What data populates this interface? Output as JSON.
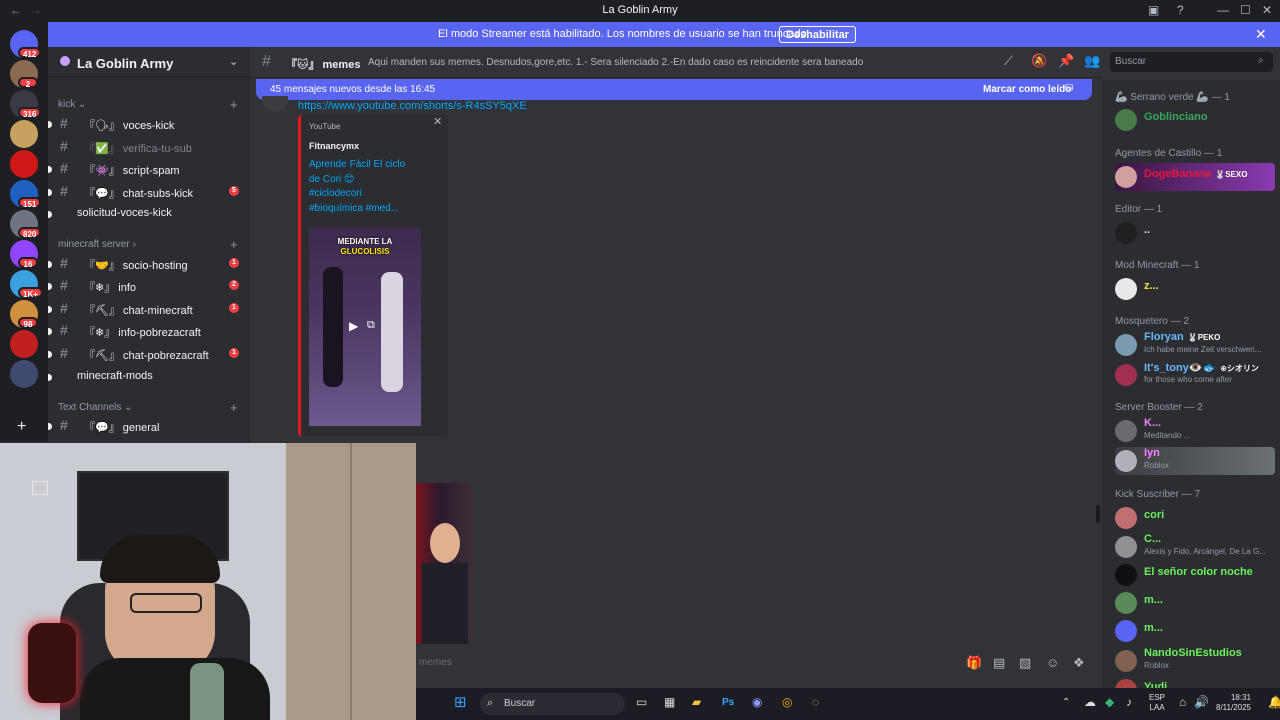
{
  "window": {
    "title": "La Goblin Army"
  },
  "banner": {
    "text": "El modo Streamer está habilitado. Los nombres de usuario se han truncado.",
    "button": "Deshabilitar"
  },
  "servers": [
    {
      "color": "#5865f2",
      "badge": "412"
    },
    {
      "color": "#8a6a50",
      "badge": "2"
    },
    {
      "color": "#3a3a44",
      "badge": "316"
    },
    {
      "color": "#c8a060",
      "badge": ""
    },
    {
      "color": "#d01818",
      "badge": ""
    },
    {
      "color": "#2060c0",
      "badge": "151"
    },
    {
      "color": "#707480",
      "badge": "820"
    },
    {
      "color": "#9146ff",
      "badge": "16"
    },
    {
      "color": "#3aa0e0",
      "badge": "1K+"
    },
    {
      "color": "#d09040",
      "badge": "98"
    },
    {
      "color": "#c02020",
      "badge": ""
    },
    {
      "color": "#404a70",
      "badge": ""
    }
  ],
  "sidebar": {
    "guild_name": "La Goblin Army",
    "categories": {
      "kick": "kick",
      "minecraft": "minecraft server",
      "text": "Text Channels"
    },
    "channels": [
      {
        "label": "『🗣』 voces-kick",
        "badge": ""
      },
      {
        "label": "『✅』 verifica-tu-sub",
        "badge": ""
      },
      {
        "label": "『👾』 script-spam",
        "badge": ""
      },
      {
        "label": "『💬』 chat-subs-kick",
        "badge": "5"
      },
      {
        "label": "solicitud-voces-kick",
        "badge": ""
      },
      {
        "label": "『🤝』 socio-hosting",
        "badge": "1"
      },
      {
        "label": "『❄』 info",
        "badge": "2"
      },
      {
        "label": "『⛏』 chat-minecraft",
        "badge": "1"
      },
      {
        "label": "『❄』 info-pobrezacraft",
        "badge": ""
      },
      {
        "label": "『⛏』 chat-pobrezacraft",
        "badge": "1"
      },
      {
        "label": "minecraft-mods",
        "badge": ""
      },
      {
        "label": "『💬』 general",
        "badge": ""
      }
    ]
  },
  "header": {
    "channel": "『🐱』 memes",
    "topic": "Aqui manden sus memes. Desnudos,gore,etc. 1.- Sera silenciado 2.-En dado caso es reincidente sera baneado",
    "search_placeholder": "Buscar"
  },
  "newbar": {
    "text": "45 mensajes nuevos desde las 16:45",
    "action": "Marcar como leído"
  },
  "message": {
    "link": "https://www.youtube.com/shorts/s-R4sSY5qXE",
    "embed": {
      "provider": "YouTube",
      "author": "Fitnancymx",
      "title_lines": [
        "Aprende Fácil El ciclo",
        "de Cori 😊",
        "#ciclodecori",
        "#bioquímica #med..."
      ],
      "thumb_text": [
        "MEDIANTE LA",
        "GLUCOLISIS"
      ]
    }
  },
  "composer": {
    "placeholder": "memes"
  },
  "members": {
    "roles": [
      {
        "label": "🦾 Serrano verde 🦾 — 1"
      },
      {
        "label": "Agentes de Castillo — 1"
      },
      {
        "label": "Editor — 1"
      },
      {
        "label": "Mod Minecraft — 1"
      },
      {
        "label": "Mosquetero — 2"
      },
      {
        "label": "Server Booster — 2"
      },
      {
        "label": "Kick Suscriber — 7"
      }
    ],
    "list": [
      {
        "name": "Goblinciano",
        "status": "",
        "tag": "",
        "color": "#3ba55c"
      },
      {
        "name": "DogeBanana",
        "status": "",
        "tag": "🐰SEXO",
        "color": "#e8183a"
      },
      {
        "name": "..",
        "status": "",
        "tag": "",
        "color": "#dbdee1"
      },
      {
        "name": "z...",
        "status": "",
        "tag": "",
        "color": "#f0e040"
      },
      {
        "name": "Floryan",
        "status": "Ich habe meine Zeit verschwen...",
        "tag": "🐰PEKO",
        "color": "#6ab7ff"
      },
      {
        "name": "It's_tony👁️🐟",
        "status": "for those who come after",
        "tag": "⊕シオリン",
        "color": "#6ab7ff"
      },
      {
        "name": "K...",
        "status": "Meditando ...",
        "tag": "",
        "color": "#f47fff"
      },
      {
        "name": "Iyn",
        "status": "Roblox",
        "tag": "",
        "color": "#f47fff"
      },
      {
        "name": "cori",
        "status": "",
        "tag": "",
        "color": "#6cf25e"
      },
      {
        "name": "C...",
        "status": "Alexis y Fido, Arcángel, De La G...",
        "tag": "",
        "color": "#6cf25e"
      },
      {
        "name": "El señor color noche",
        "status": "",
        "tag": "",
        "color": "#6cf25e"
      },
      {
        "name": "m...",
        "status": "",
        "tag": "",
        "color": "#6cf25e"
      },
      {
        "name": "m...",
        "status": "",
        "tag": "",
        "color": "#6cf25e"
      },
      {
        "name": "NandoSinEstudios",
        "status": "Roblox",
        "tag": "",
        "color": "#6cf25e"
      },
      {
        "name": "Yudi",
        "status": "",
        "tag": "",
        "color": "#6cf25e"
      }
    ]
  },
  "taskbar": {
    "search": "Buscar",
    "lang": "ESP",
    "lang2": "LAA",
    "time": "18:31",
    "date": "8/11/2025"
  }
}
